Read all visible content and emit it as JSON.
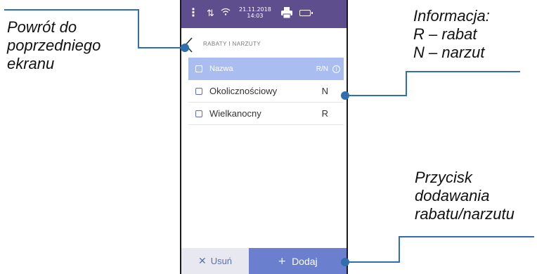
{
  "annotations": {
    "back": [
      "Powrót do",
      "poprzedniego",
      "ekranu"
    ],
    "info": [
      "Informacja:",
      "R – rabat",
      "N – narzut"
    ],
    "add": [
      "Przycisk",
      "dodawania",
      "rabatu/narzutu"
    ]
  },
  "statusbar": {
    "date": "21.11.2018",
    "time": "14:03",
    "icons": [
      "menu-icon",
      "sync-icon",
      "wifi-icon",
      "printer-icon",
      "battery-icon"
    ]
  },
  "screen": {
    "title": "RABATY I NARZUTY"
  },
  "table": {
    "header": {
      "name": "Nazwa",
      "type": "R/N",
      "info_glyph": "i"
    },
    "rows": [
      {
        "name": "Okolicznościowy",
        "type": "N"
      },
      {
        "name": "Wielkanocny",
        "type": "R"
      }
    ]
  },
  "buttons": {
    "remove_label": "Usuń",
    "remove_glyph": "✕",
    "add_label": "Dodaj",
    "add_glyph": "+"
  },
  "colors": {
    "statusbar": "#5e4e8e",
    "header_row": "#aabdf1",
    "add_button": "#6a7fce",
    "remove_button": "#e8e8f0",
    "leader_line": "#2f6fb0"
  }
}
